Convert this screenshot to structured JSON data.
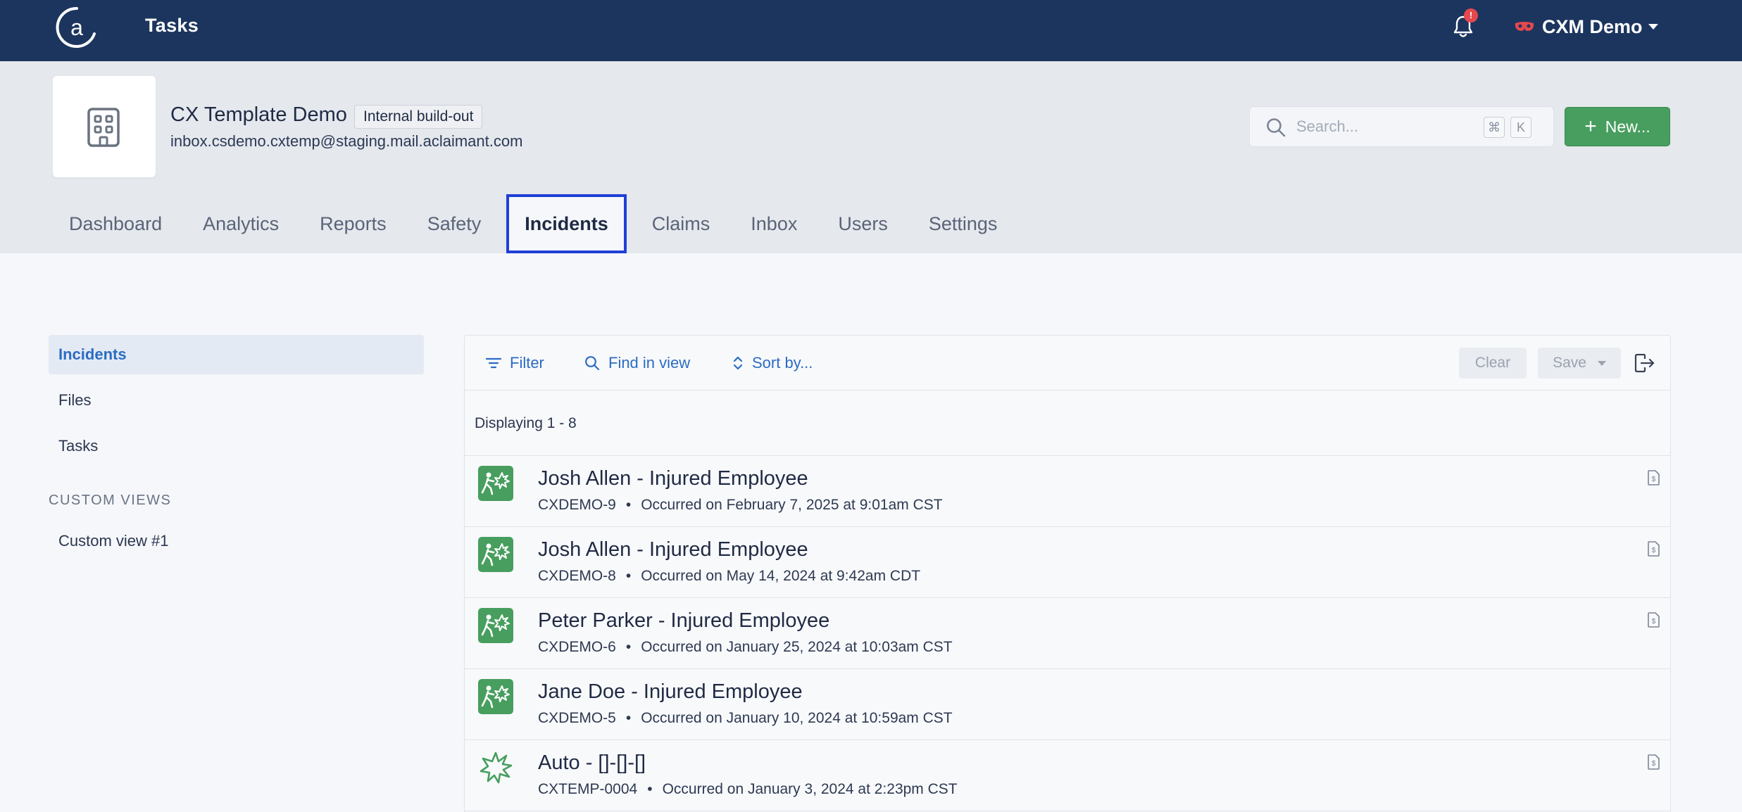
{
  "topbar": {
    "app_title": "Tasks",
    "notification_badge": "!",
    "user_name": "CXM Demo"
  },
  "org": {
    "name": "CX Template Demo",
    "tag": "Internal build-out",
    "email": "inbox.csdemo.cxtemp@staging.mail.aclaimant.com"
  },
  "search": {
    "placeholder": "Search...",
    "shortcut_key1": "⌘",
    "shortcut_key2": "K"
  },
  "new_button_label": "New...",
  "tabs": [
    {
      "label": "Dashboard"
    },
    {
      "label": "Analytics"
    },
    {
      "label": "Reports"
    },
    {
      "label": "Safety"
    },
    {
      "label": "Incidents"
    },
    {
      "label": "Claims"
    },
    {
      "label": "Inbox"
    },
    {
      "label": "Users"
    },
    {
      "label": "Settings"
    }
  ],
  "active_tab": "Incidents",
  "sidebar": {
    "items": [
      {
        "label": "Incidents"
      },
      {
        "label": "Files"
      },
      {
        "label": "Tasks"
      }
    ],
    "custom_heading": "CUSTOM VIEWS",
    "custom_items": [
      {
        "label": "Custom view #1"
      }
    ]
  },
  "toolbar": {
    "filter_label": "Filter",
    "find_label": "Find in view",
    "sort_label": "Sort by...",
    "clear_label": "Clear",
    "save_label": "Save"
  },
  "list": {
    "count_text": "Displaying 1 - 8",
    "separator": "•",
    "rows": [
      {
        "title": "Josh Allen - Injured Employee",
        "id": "CXDEMO-9",
        "occurred": "Occurred on February 7, 2025 at 9:01am CST",
        "icon": "injured-employee-icon"
      },
      {
        "title": "Josh Allen - Injured Employee",
        "id": "CXDEMO-8",
        "occurred": "Occurred on May 14, 2024 at 9:42am CDT",
        "icon": "injured-employee-icon"
      },
      {
        "title": "Peter Parker - Injured Employee",
        "id": "CXDEMO-6",
        "occurred": "Occurred on January 25, 2024 at 10:03am CST",
        "icon": "injured-employee-icon"
      },
      {
        "title": "Jane Doe - Injured Employee",
        "id": "CXDEMO-5",
        "occurred": "Occurred on January 10, 2024 at 10:59am CST",
        "icon": "injured-employee-icon"
      },
      {
        "title": "Auto - []-[]-[]",
        "id": "CXTEMP-0004",
        "occurred": "Occurred on January 3, 2024 at 2:23pm CST",
        "icon": "auto-incident-burst-icon"
      }
    ]
  },
  "colors": {
    "topbar": "#1c355e",
    "accent_green": "#479e5e",
    "link_blue": "#2b6cc4",
    "active_tab_outline": "#1f3fd6"
  }
}
